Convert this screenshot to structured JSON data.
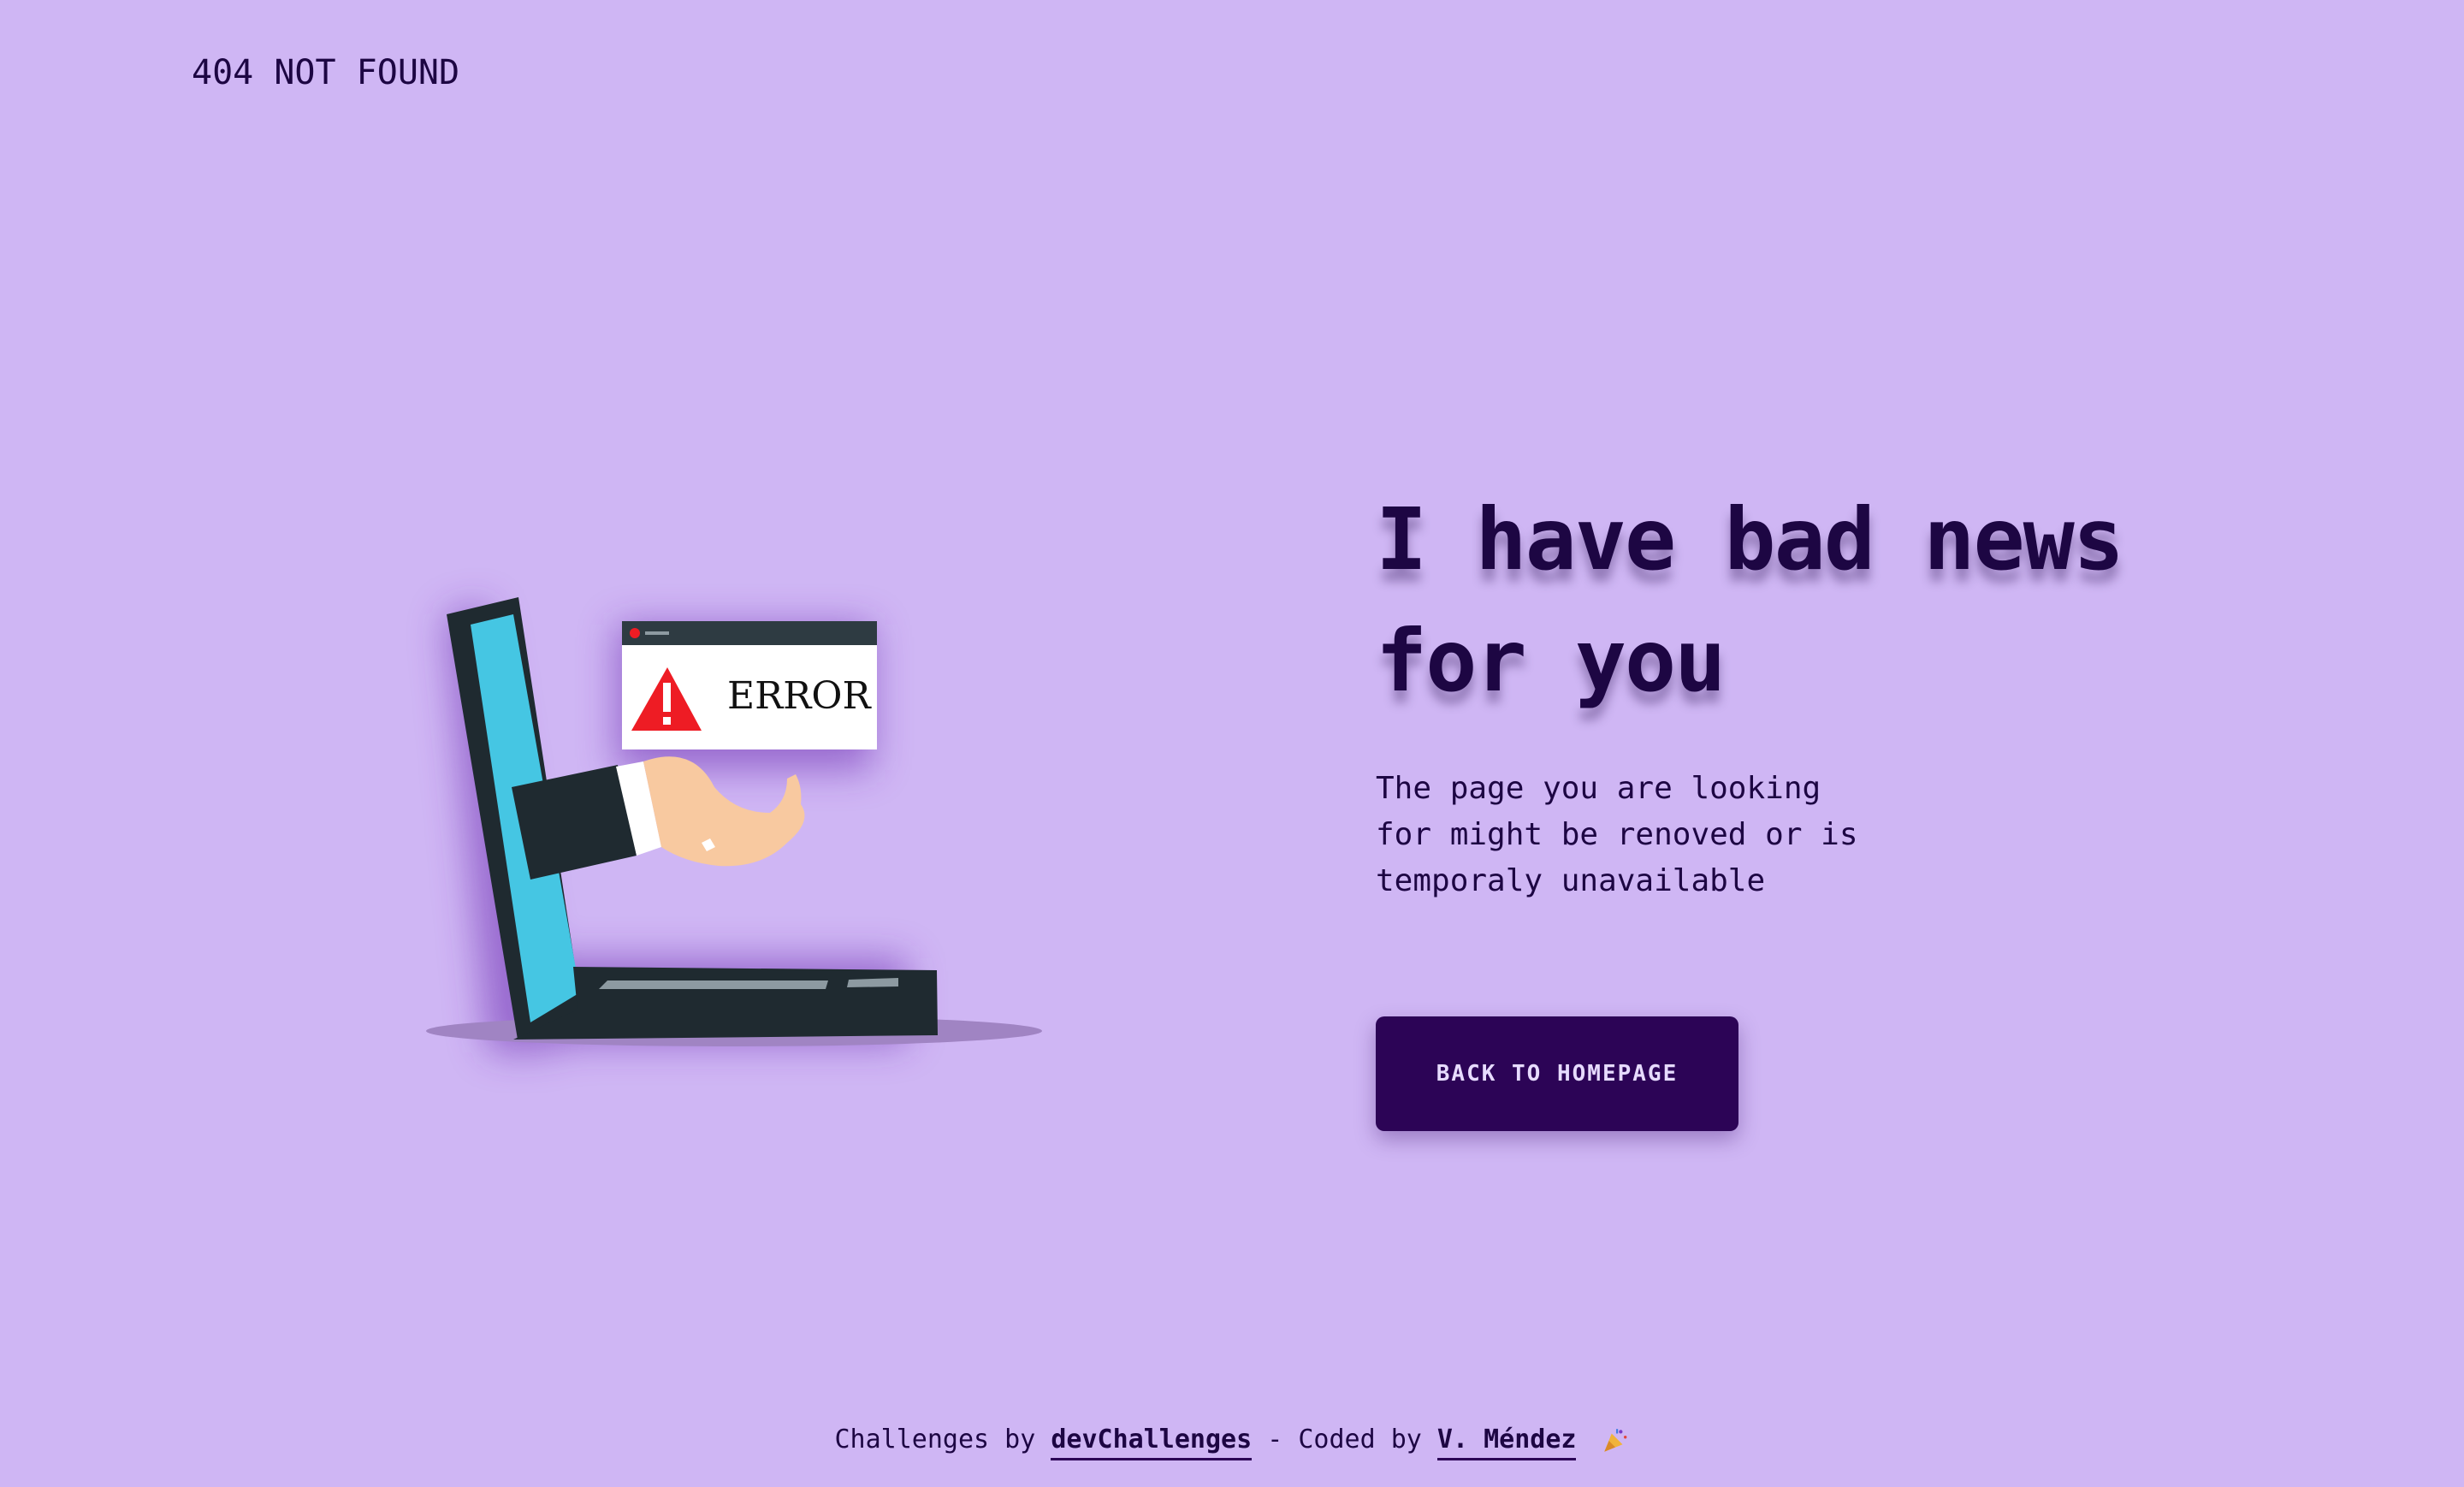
{
  "header": {
    "brand": "404 NOT FOUND"
  },
  "illustration": {
    "error_label": "ERROR"
  },
  "main": {
    "headline_line1": "I have bad news",
    "headline_line2": "for you",
    "description_line1": "The page you are looking",
    "description_line2": "for might be renoved or is",
    "description_line3": "temporaly unavailable",
    "cta_label": "BACK TO HOMEPAGE"
  },
  "footer": {
    "prefix": "Challenges by ",
    "challenges_link": "devChallenges",
    "middle": " - Coded by ",
    "author_link": "V. Méndez",
    "emoji_icon": "party-popper-icon"
  },
  "colors": {
    "background": "#cfb6f4",
    "text": "#1d0643",
    "button": "#2c0456",
    "screen": "#45c6e3",
    "laptop": "#1f2a30",
    "error_red": "#ee1c24"
  }
}
